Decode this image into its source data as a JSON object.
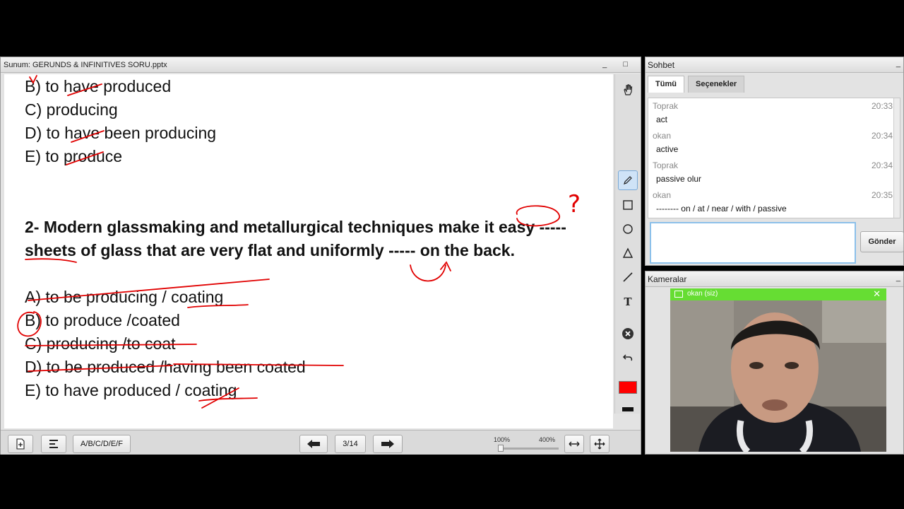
{
  "presentation": {
    "title": "Sunum: GERUNDS & INFINITIVES SORU.pptx",
    "window_buttons": "_ □",
    "slide_lines": [
      "B) to have produced",
      "C) producing",
      "D) to have been producing",
      "E) to produce",
      "2- Modern glassmaking and metallurgical techniques make it easy -----",
      "sheets of glass that are very flat and uniformly ----- on the back.",
      "A) to be producing / coating",
      "B) to produce /coated",
      "C) producing /to coat",
      "D) to be produced /having been coated",
      "E) to have produced / coating"
    ],
    "annotation_question_mark": "?",
    "tools": [
      "hand-icon",
      "pencil-icon",
      "rectangle-icon",
      "circle-icon",
      "triangle-icon",
      "line-icon",
      "text-icon",
      "clear-icon",
      "undo-icon"
    ],
    "text_tool_label": "T",
    "pen_color": "#ff0000",
    "bottom": {
      "layout_label": "A/B/C/D/E/F",
      "page_indicator": "3/14",
      "zoom_min": "100%",
      "zoom_max": "400%"
    }
  },
  "chat": {
    "title": "Sohbet",
    "minimize": "_",
    "tabs": [
      "Tümü",
      "Seçenekler"
    ],
    "messages": [
      {
        "name": "Toprak",
        "time": "20:33",
        "text": "act"
      },
      {
        "name": "okan",
        "time": "20:34",
        "text": "active"
      },
      {
        "name": "Toprak",
        "time": "20:34",
        "text": "passive olur"
      },
      {
        "name": "okan",
        "time": "20:35",
        "text": "-------- on / at / near / with / passive"
      }
    ],
    "input_value": "",
    "send_label": "Gönder"
  },
  "cameras": {
    "title": "Kameralar",
    "minimize": "_",
    "feed_label": "okan (siz)",
    "close": "✕"
  },
  "colors": {
    "ink": "#e10000",
    "cam_bar": "#66dd33",
    "input_border": "#8cc0ea"
  }
}
